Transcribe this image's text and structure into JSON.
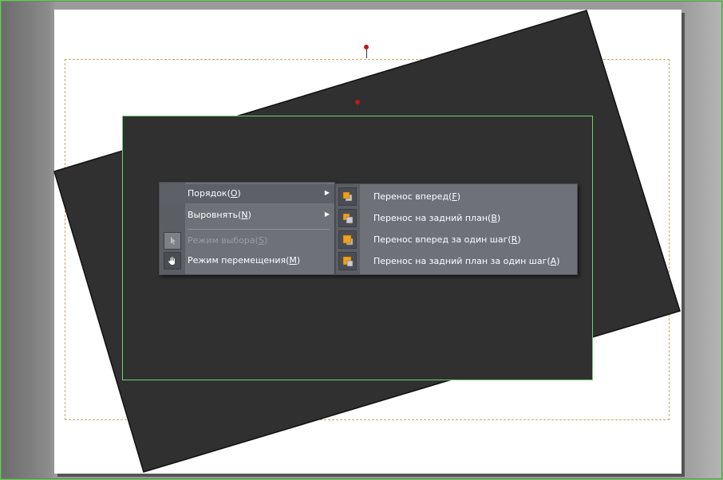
{
  "menu": {
    "items": [
      {
        "label": "Порядок(",
        "key": "O",
        "tail": ")",
        "has_submenu": true,
        "state": "hover"
      },
      {
        "label": "Выровнять(",
        "key": "N",
        "tail": ")",
        "has_submenu": true,
        "state": "normal"
      },
      {
        "label": "Режим выбора(",
        "key": "S",
        "tail": ")",
        "has_submenu": false,
        "state": "disabled"
      },
      {
        "label": "Режим перемещения(",
        "key": "M",
        "tail": ")",
        "has_submenu": false,
        "state": "normal"
      }
    ],
    "icons": [
      "select-arrow-icon",
      "hand-move-icon"
    ]
  },
  "submenu": {
    "items": [
      {
        "label": "Перенос вперед(",
        "key": "F",
        "tail": ")",
        "icon": "bring-to-front-icon"
      },
      {
        "label": "Перенос на задний план(",
        "key": "B",
        "tail": ")",
        "icon": "send-to-back-icon"
      },
      {
        "label": "Перенос вперед за один шаг(",
        "key": "R",
        "tail": ")",
        "icon": "bring-forward-icon"
      },
      {
        "label": "Перенос на задний план за один шаг(",
        "key": "A",
        "tail": ")",
        "icon": "send-backward-icon"
      }
    ]
  },
  "colors": {
    "shape_fill": "#303030",
    "selection_border": "#6fd06a",
    "guide_dash": "#c8a85a",
    "pin": "#c0181e",
    "menu_bg": "#6e7178",
    "icon_orange": "#f0a020"
  }
}
